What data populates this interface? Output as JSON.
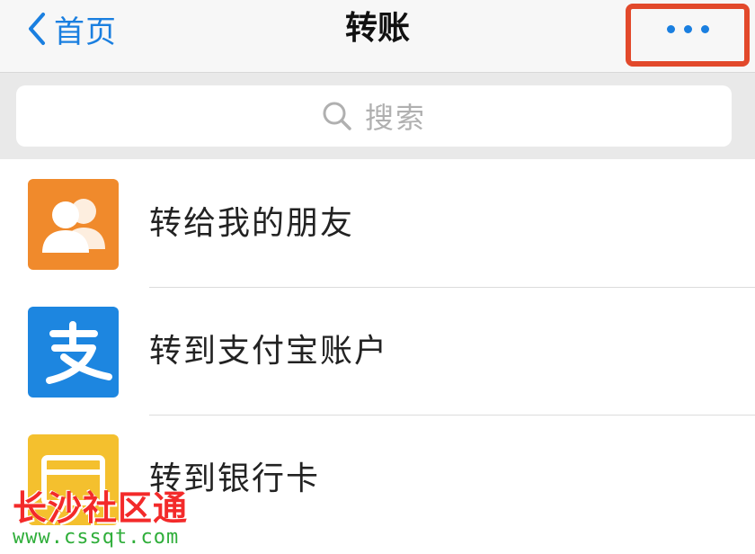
{
  "header": {
    "back_label": "首页",
    "title": "转账",
    "more_icon": "more-dots-icon",
    "accent_color": "#1a7fe0",
    "highlight_color": "#e2492b"
  },
  "search": {
    "placeholder": "搜索",
    "icon": "search-icon"
  },
  "options": [
    {
      "label": "转给我的朋友",
      "icon": "friends-icon",
      "color": "#f08a2c"
    },
    {
      "label": "转到支付宝账户",
      "icon": "alipay-icon",
      "color": "#1d86e0"
    },
    {
      "label": "转到银行卡",
      "icon": "bank-card-icon",
      "color": "#f4c02e"
    }
  ],
  "watermark": {
    "text": "长沙社区通",
    "url": "www.cssqt.com"
  }
}
